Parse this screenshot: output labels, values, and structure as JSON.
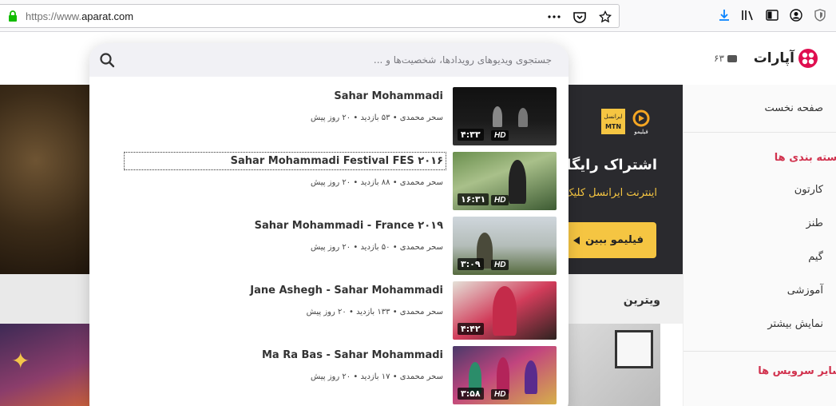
{
  "browser": {
    "url_prefix": "https://www.",
    "url_domain": "aparat.com"
  },
  "header": {
    "logo_text": "آپارات",
    "upload_count": "۶۳"
  },
  "search": {
    "placeholder": "جستجوی ویدیوهای رویدادها، شخصیت‌ها و ..."
  },
  "results": [
    {
      "title": "Sahar Mohammadi",
      "channel": "سحر محمدی",
      "views": "۵۳ بازدید",
      "age": "۲۰ روز پیش",
      "duration": "۴:۳۳",
      "hd": "HD"
    },
    {
      "title": "Sahar Mohammadi Festival FES ۲۰۱۶",
      "channel": "سحر محمدی",
      "views": "۸۸ بازدید",
      "age": "۲۰ روز پیش",
      "duration": "۱۶:۳۱",
      "hd": "HD"
    },
    {
      "title": "Sahar Mohammadi - France ۲۰۱۹",
      "channel": "سحر محمدی",
      "views": "۵۰ بازدید",
      "age": "۲۰ روز پیش",
      "duration": "۳:۰۹",
      "hd": "HD"
    },
    {
      "title": "Jane Ashegh - Sahar Mohammadi",
      "channel": "سحر محمدی",
      "views": "۱۳۳ بازدید",
      "age": "۲۰ روز پیش",
      "duration": "۴:۴۲",
      "hd": ""
    },
    {
      "title": "Ma Ra Bas - Sahar Mohammadi",
      "channel": "سحر محمدی",
      "views": "۱۷ بازدید",
      "age": "۲۰ روز پیش",
      "duration": "۳:۵۸",
      "hd": "HD"
    }
  ],
  "meta_separator": "•",
  "promo": {
    "brand": "فیلیمو",
    "operator": "ایرانسل",
    "title": "اشتراک رایگان",
    "subtitle": "اینترنت ایرانسل کلیک",
    "button": "فیلیمو ببین"
  },
  "vitrin": {
    "label": "ویترین"
  },
  "sidebar": {
    "home": "صفحه نخست",
    "categories_heading": "دسته بندی ها",
    "items": [
      "کارتون",
      "طنز",
      "گیم",
      "آموزشی",
      "نمایش بیشتر"
    ],
    "services_heading": "سایر سرویس ها"
  },
  "colors": {
    "accent": "#d1324e",
    "promo_yellow": "#f5c542",
    "search_bg": "#f1f1f5"
  }
}
